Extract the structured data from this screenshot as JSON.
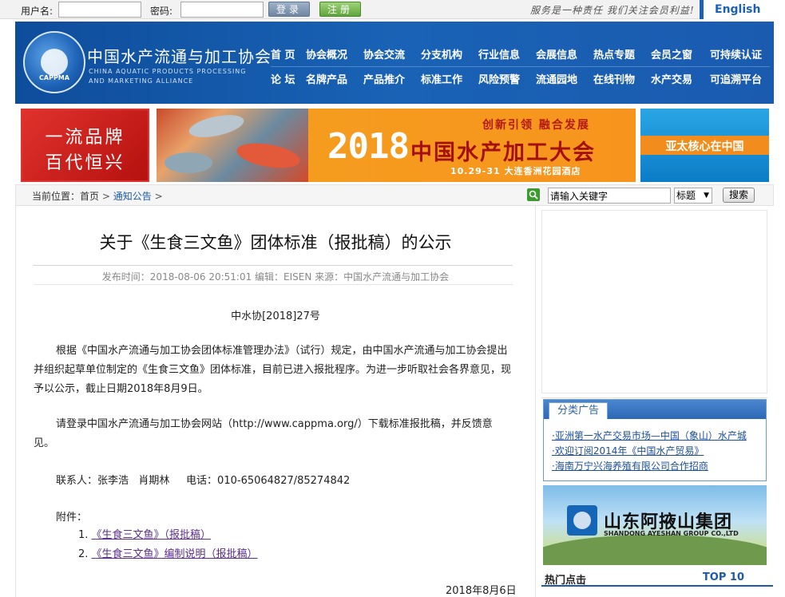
{
  "topbar": {
    "username_label": "用户名:",
    "password_label": "密码:",
    "login_label": "登录",
    "register_label": "注册",
    "slogan": "服务是一种责任 我们关注会员利益!",
    "english_label": "English"
  },
  "header": {
    "org_name_cn": "中国水产流通与加工协会",
    "org_name_en_line1": "CHINA AQUATIC PRODUCTS PROCESSING",
    "org_name_en_line2": "AND MARKETING ALLIANCE",
    "logo_text": "CAPPMA",
    "nav_row1": [
      "首 页",
      "协会概况",
      "协会交流",
      "分支机构",
      "行业信息",
      "会展信息",
      "热点专题",
      "会员之窗",
      "可持续认证"
    ],
    "nav_row2": [
      "论 坛",
      "名牌产品",
      "产品推介",
      "标准工作",
      "风险预警",
      "流通园地",
      "在线刊物",
      "水产交易",
      "可追溯平台"
    ]
  },
  "banner": {
    "left_line1": "一流品牌",
    "left_line2": "百代恒兴",
    "mid_slogan": "创新引领 融合发展",
    "mid_year": "2018",
    "mid_conf": "中国水产加工大会",
    "mid_date": "10.29-31 大连香洲花园酒店",
    "right_text": "亚太核心在中国"
  },
  "breadcrumb": {
    "label": "当前位置：",
    "home": "首页",
    "current": "通知公告",
    "sep": ">"
  },
  "search": {
    "value": "请输入关键字",
    "select": "标题",
    "button": "搜索"
  },
  "article": {
    "title": "关于《生食三文鱼》团体标准（报批稿）的公示",
    "meta": "发布时间：2018-08-06 20:51:01 编辑：EISEN 来源：中国水产流通与加工协会",
    "doc_no": "中水协[2018]27号",
    "para1": "根据《中国水产流通与加工协会团体标准管理办法》（试行）规定，由中国水产流通与加工协会提出并组织起草单位制定的《生食三文鱼》团体标准，目前已进入报批程序。为进一步听取社会各界意见，现予以公示，截止日期2018年8月9日。",
    "para2": "请登录中国水产流通与加工协会网站（http://www.cappma.org/）下载标准报批稿，并反馈意见。",
    "contact": "联系人：张李浩   肖期林     电话：010-65064827/85274842",
    "attach_label": "附件：",
    "attach1_no": "1.",
    "attach1": "《生食三文鱼》（报批稿）",
    "attach2_no": "2.",
    "attach2": "《生食三文鱼》编制说明（报批稿）",
    "date": "2018年8月6日"
  },
  "sidebar": {
    "ad_tab": "分类广告",
    "ads": [
      "·亚洲第一水产交易市场—中国（象山）水产城",
      "·欢迎订阅2014年《中国水产贸易》",
      "·海南万宁兴海养殖有限公司合作招商"
    ],
    "group_cn": "山东阿掖山集团",
    "group_en": "SHANDONG AYESHAN GROUP CO.,LTD",
    "hot_label": "热门点击",
    "top10": "TOP 10"
  }
}
